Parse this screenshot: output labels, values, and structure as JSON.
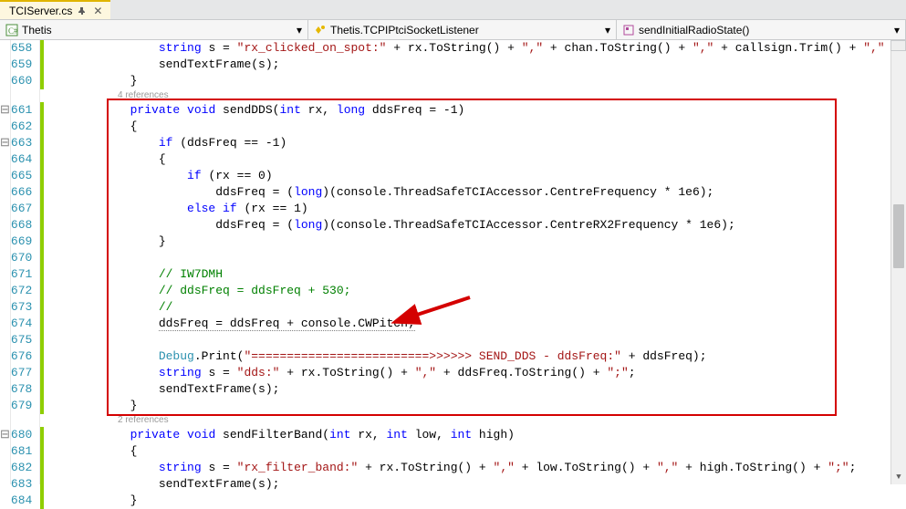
{
  "tab": {
    "title": "TCIServer.cs"
  },
  "nav": {
    "scope": "Thetis",
    "type": "Thetis.TCPIPtciSocketListener",
    "member": "sendInitialRadioState()"
  },
  "codelens": {
    "sendDDS_refs": "4 references",
    "sendFilterBand_refs": "2 references"
  },
  "lines": {
    "l658_a": "string",
    "l658_b": " s = ",
    "l658_c": "\"rx_clicked_on_spot:\"",
    "l658_d": " + rx.ToString() + ",
    "l658_e": "\",\"",
    "l658_f": " + chan.ToString() + ",
    "l658_g": "\",\"",
    "l658_h": " + callsign.Trim() + ",
    "l658_i": "\",\"",
    "l658_j": " + ",
    "l659": "sendTextFrame(s);",
    "l660": "}",
    "l661_a": "private",
    "l661_b": " void",
    "l661_c": " sendDDS(",
    "l661_d": "int",
    "l661_e": " rx, ",
    "l661_f": "long",
    "l661_g": " ddsFreq = -1)",
    "l662": "{",
    "l663_a": "if",
    "l663_b": " (ddsFreq == -1)",
    "l664": "{",
    "l665_a": "if",
    "l665_b": " (rx == 0)",
    "l666_a": "ddsFreq = (",
    "l666_b": "long",
    "l666_c": ")(console.ThreadSafeTCIAccessor.CentreFrequency * 1e6);",
    "l667_a": "else",
    "l667_b": " if",
    "l667_c": " (rx == 1)",
    "l668_a": "ddsFreq = (",
    "l668_b": "long",
    "l668_c": ")(console.ThreadSafeTCIAccessor.CentreRX2Frequency * 1e6);",
    "l669": "}",
    "l671": "// IW7DMH",
    "l672": "// ddsFreq = ddsFreq + 530;",
    "l673": "//",
    "l674": "ddsFreq = ddsFreq + console.CWPitch;",
    "l676_a": "Debug",
    "l676_b": ".Print(",
    "l676_c": "\"=========================>>>>>> SEND_DDS - ddsFreq:\"",
    "l676_d": " + ddsFreq);",
    "l677_a": "string",
    "l677_b": " s = ",
    "l677_c": "\"dds:\"",
    "l677_d": " + rx.ToString() + ",
    "l677_e": "\",\"",
    "l677_f": " + ddsFreq.ToString() + ",
    "l677_g": "\";\"",
    "l677_h": ";",
    "l678": "sendTextFrame(s);",
    "l679": "}",
    "l680_a": "private",
    "l680_b": " void",
    "l680_c": " sendFilterBand(",
    "l680_d": "int",
    "l680_e": " rx, ",
    "l680_f": "int",
    "l680_g": " low, ",
    "l680_h": "int",
    "l680_i": " high)",
    "l681": "{",
    "l682_a": "string",
    "l682_b": " s = ",
    "l682_c": "\"rx_filter_band:\"",
    "l682_d": " + rx.ToString() + ",
    "l682_e": "\",\"",
    "l682_f": " + low.ToString() + ",
    "l682_g": "\",\"",
    "l682_h": " + high.ToString() + ",
    "l682_i": "\";\"",
    "l682_j": ";",
    "l683": "sendTextFrame(s);",
    "l684": "}"
  },
  "lineNumbers": [
    "658",
    "659",
    "660",
    "",
    "661",
    "662",
    "663",
    "664",
    "665",
    "666",
    "667",
    "668",
    "669",
    "670",
    "671",
    "672",
    "673",
    "674",
    "675",
    "676",
    "677",
    "678",
    "679",
    "",
    "680",
    "681",
    "682",
    "683",
    "684"
  ],
  "outlineGlyphs": [
    " ",
    " ",
    " ",
    " ",
    "⊟",
    " ",
    "⊟",
    " ",
    " ",
    " ",
    " ",
    " ",
    " ",
    " ",
    " ",
    " ",
    " ",
    " ",
    " ",
    " ",
    " ",
    " ",
    " ",
    " ",
    "⊟",
    " ",
    " ",
    " ",
    " "
  ]
}
